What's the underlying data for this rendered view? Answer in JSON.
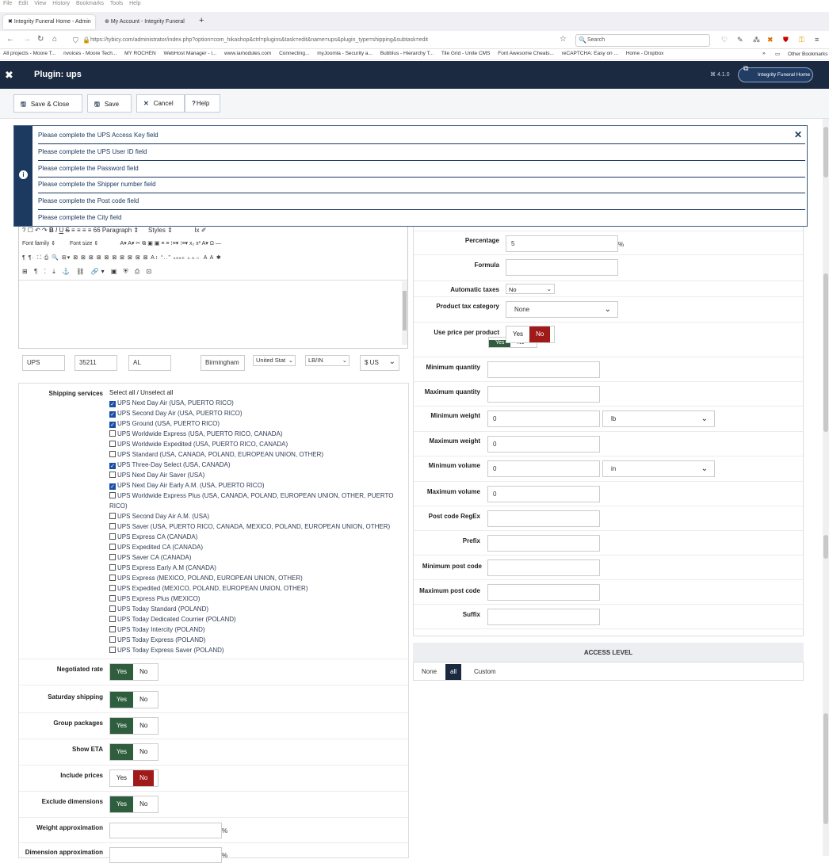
{
  "browser": {
    "menu": [
      "File",
      "Edit",
      "View",
      "History",
      "Bookmarks",
      "Tools",
      "Help"
    ],
    "tabs": [
      {
        "label": "Integrity Funeral Home - Admin"
      },
      {
        "label": "My Account - Integrity Funeral"
      }
    ],
    "new_tab": "+",
    "url": "https://tybicy.com/administrator/index.php?option=com_hikashop&ctrl=plugins&task=edit&name=ups&plugin_type=shipping&subtask=edit",
    "search_placeholder": "Search",
    "bookmarks": [
      "All projects - Moore T...",
      "nvoices - Moore Tech...",
      "MY ROCHEN",
      "WebHost Manager - i...",
      "www.iamodules.com",
      "Connecting...",
      "myJoomla - Security a...",
      "Bubblus - Hierarchy T...",
      "Tile Grid - Unite CMS",
      "Font Awesome Cheats...",
      "reCAPTCHA: Easy on ...",
      "Home - Dropbox"
    ],
    "bookmarks_more": "»",
    "other_bookmarks": "Other Bookmarks"
  },
  "header": {
    "title": "Plugin: ups",
    "version": "⌘ 4.1.0",
    "site_button": "Integrity Funeral Home"
  },
  "toolbar": {
    "save_close": "Save & Close",
    "save": "Save",
    "cancel": "Cancel",
    "help": "Help"
  },
  "alert": {
    "messages": [
      "Please complete the UPS Access Key field",
      "Please complete the UPS User ID field",
      "Please complete the Password field",
      "Please complete the Shipper number field",
      "Please complete the Post code field",
      "Please complete the City field"
    ]
  },
  "editor": {
    "row1": [
      "?",
      "☐",
      "↶",
      "↷",
      "B",
      "I",
      "U",
      "S",
      "≡",
      "≡",
      "≡",
      "≡",
      "66",
      "Paragraph",
      "⇕",
      "Styles",
      "⇕",
      "Ix",
      "✐"
    ],
    "row2": [
      "Font family",
      "⇕",
      "Font size",
      "⇕",
      "A",
      "▾",
      "A",
      "▾",
      "✂",
      "⧉",
      "▣",
      "▣",
      "≡",
      "≡",
      "⁝≡",
      "▾",
      "⁝≡",
      "▾",
      "x₂",
      "x²",
      "A",
      "▾",
      "Ω",
      "—"
    ],
    "row3": [
      "¶",
      "¶·",
      "⛶",
      "⎙",
      "🔍",
      "⊞",
      "▾",
      "⊠",
      "⊠",
      "⊠",
      "⊠",
      "⊠",
      "⊠",
      "⊠",
      "⊠",
      "⊠",
      "⊠",
      "A↕",
      "“..”",
      "ABBR",
      "A.B.C.",
      "A",
      "A",
      "✱"
    ],
    "row4": [
      "⊞",
      "¶",
      "⁚",
      "⤓",
      "⚓",
      "⛓",
      "🔗",
      "▾",
      "▣",
      "⛨",
      "⎙",
      "⊡"
    ]
  },
  "address": {
    "name": "UPS",
    "zip": "35211",
    "state": "AL",
    "city": "Birmingham",
    "country": "United Stat",
    "units": "LB/IN",
    "currency": "$ US"
  },
  "left": {
    "shipping_services_label": "Shipping services",
    "select_all": "Select all / Unselect all",
    "services": [
      {
        "label": "UPS Next Day Air (USA, PUERTO RICO)",
        "checked": true
      },
      {
        "label": "UPS Second Day Air (USA, PUERTO RICO)",
        "checked": true
      },
      {
        "label": "UPS Ground (USA, PUERTO RICO)",
        "checked": true
      },
      {
        "label": "UPS Worldwide Express (USA, PUERTO RICO, CANADA)",
        "checked": false
      },
      {
        "label": "UPS Worldwide Expedited (USA, PUERTO RICO, CANADA)",
        "checked": false
      },
      {
        "label": "UPS Standard (USA, CANADA, POLAND, EUROPEAN UNION, OTHER)",
        "checked": false
      },
      {
        "label": "UPS Three-Day Select (USA, CANADA)",
        "checked": true
      },
      {
        "label": "UPS Next Day Air Saver (USA)",
        "checked": false
      },
      {
        "label": "UPS Next Day Air Early A.M. (USA, PUERTO RICO)",
        "checked": true
      },
      {
        "label": "UPS Worldwide Express Plus (USA, CANADA, POLAND, EUROPEAN UNION, OTHER, PUERTO",
        "checked": false,
        "wrap": "RICO)"
      },
      {
        "label": "UPS Second Day Air A.M. (USA)",
        "checked": false
      },
      {
        "label": "UPS Saver (USA, PUERTO RICO, CANADA, MEXICO, POLAND, EUROPEAN UNION, OTHER)",
        "checked": false
      },
      {
        "label": "UPS Express CA (CANADA)",
        "checked": false
      },
      {
        "label": "UPS Expedited CA (CANADA)",
        "checked": false
      },
      {
        "label": "UPS Saver CA (CANADA)",
        "checked": false
      },
      {
        "label": "UPS Express Early A.M (CANADA)",
        "checked": false
      },
      {
        "label": "UPS Express (MEXICO, POLAND, EUROPEAN UNION, OTHER)",
        "checked": false
      },
      {
        "label": "UPS Expedited (MEXICO, POLAND, EUROPEAN UNION, OTHER)",
        "checked": false
      },
      {
        "label": "UPS Express Plus (MEXICO)",
        "checked": false
      },
      {
        "label": "UPS Today Standard (POLAND)",
        "checked": false
      },
      {
        "label": "UPS Today Dedicated Courrier (POLAND)",
        "checked": false
      },
      {
        "label": "UPS Today Intercity (POLAND)",
        "checked": false
      },
      {
        "label": "UPS Today Express (POLAND)",
        "checked": false
      },
      {
        "label": "UPS Today Express Saver (POLAND)",
        "checked": false
      }
    ],
    "toggles": [
      {
        "label": "Negotiated rate",
        "value": "Yes"
      },
      {
        "label": "Saturday shipping",
        "value": "Yes"
      },
      {
        "label": "Group packages",
        "value": "Yes"
      },
      {
        "label": "Show ETA",
        "value": "Yes"
      },
      {
        "label": "Include prices",
        "value": "No"
      },
      {
        "label": "Exclude dimensions",
        "value": "Yes"
      }
    ],
    "yes": "Yes",
    "no": "No",
    "weight_approx": "Weight approximation",
    "dimension_approx": "Dimension approximation",
    "pct": "%"
  },
  "right": {
    "percentage_label": "Percentage",
    "percentage_value": "5",
    "pct": "%",
    "formula_label": "Formula",
    "auto_taxes_label": "Automatic taxes",
    "auto_taxes_value": "No",
    "tax_cat_label": "Product tax category",
    "tax_cat_value": "None",
    "price_per_product_label": "Use price per product",
    "price_per_product_value": "No",
    "hidden_yes": "Yes",
    "hidden_no": "No",
    "min_qty": "Minimum quantity",
    "max_qty": "Maximum quantity",
    "min_weight": "Minimum weight",
    "min_weight_value": "0",
    "weight_unit": "lb",
    "max_weight": "Maximum weight",
    "max_weight_value": "0",
    "min_volume": "Minimum volume",
    "min_volume_value": "0",
    "volume_unit": "in",
    "max_volume": "Maximum volume",
    "max_volume_value": "0",
    "postcode_regex": "Post code RegEx",
    "prefix": "Prefix",
    "min_postcode": "Minimum post code",
    "max_postcode": "Maximum post code",
    "suffix": "Suffix"
  },
  "access": {
    "title": "ACCESS LEVEL",
    "options": [
      "None",
      "all",
      "Custom"
    ],
    "selected": "all"
  },
  "colors": {
    "header": "#1b2a40",
    "yes_green": "#2e5e3d",
    "no_red": "#a11a1a",
    "alert": "#1c3a60"
  }
}
